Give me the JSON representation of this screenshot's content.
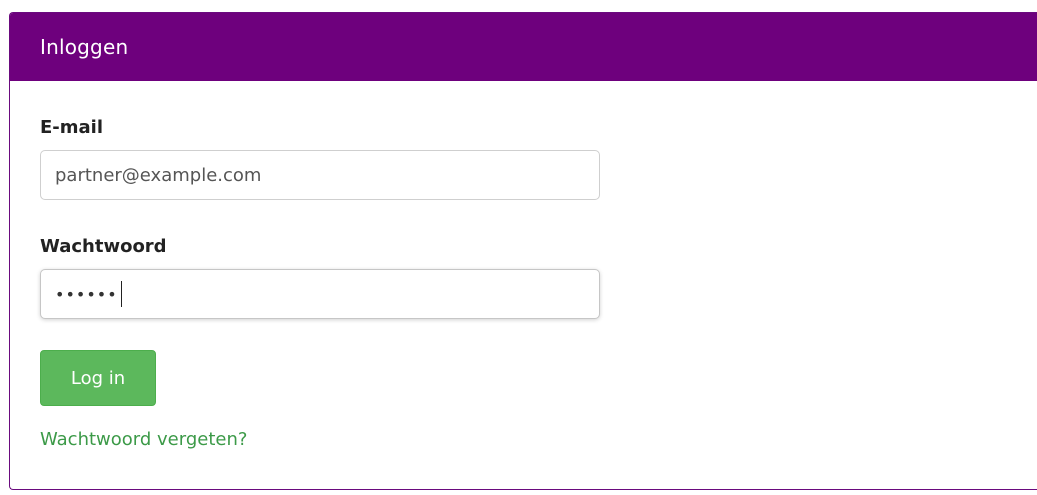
{
  "panel": {
    "title": "Inloggen"
  },
  "form": {
    "email_label": "E-mail",
    "email_value": "partner@example.com",
    "password_label": "Wachtwoord",
    "password_masked": "••••••",
    "login_label": "Log in",
    "forgot_label": "Wachtwoord vergeten?"
  },
  "colors": {
    "header_bg": "#6e007d",
    "button_bg": "#5cb85c",
    "link": "#3c9a48"
  }
}
